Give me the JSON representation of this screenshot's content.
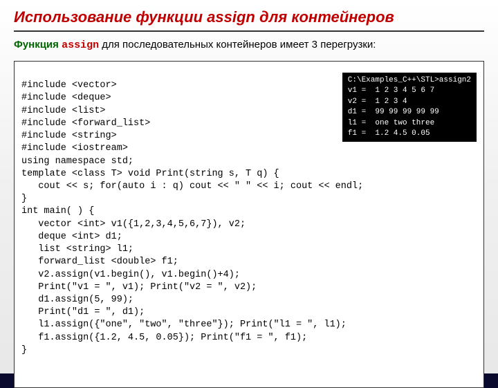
{
  "title": "Использование функции assign для контейнеров",
  "subtitle": {
    "pre": "Функция ",
    "assign": "assign",
    "post": " для последовательных контейнеров имеет 3 перегрузки:"
  },
  "code": [
    "#include <vector>",
    "#include <deque>",
    "#include <list>",
    "#include <forward_list>",
    "#include <string>",
    "#include <iostream>",
    "using namespace std;",
    "template <class T> void Print(string s, T q) {",
    "   cout << s; for(auto i : q) cout << \" \" << i; cout << endl;",
    "}",
    "int main( ) {",
    "   vector <int> v1({1,2,3,4,5,6,7}), v2;",
    "   deque <int> d1;",
    "   list <string> l1;",
    "   forward_list <double> f1;",
    "   v2.assign(v1.begin(), v1.begin()+4);",
    "   Print(\"v1 = \", v1); Print(\"v2 = \", v2);",
    "   d1.assign(5, 99);",
    "   Print(\"d1 = \", d1);",
    "   l1.assign({\"one\", \"two\", \"three\"}); Print(\"l1 = \", l1);",
    "   f1.assign({1.2, 4.5, 0.05}); Print(\"f1 = \", f1);",
    "}"
  ],
  "console": [
    "C:\\Examples_C++\\STL>assign2",
    "v1 =  1 2 3 4 5 6 7",
    "v2 =  1 2 3 4",
    "d1 =  99 99 99 99 99",
    "l1 =  one two three",
    "f1 =  1.2 4.5 0.05"
  ]
}
